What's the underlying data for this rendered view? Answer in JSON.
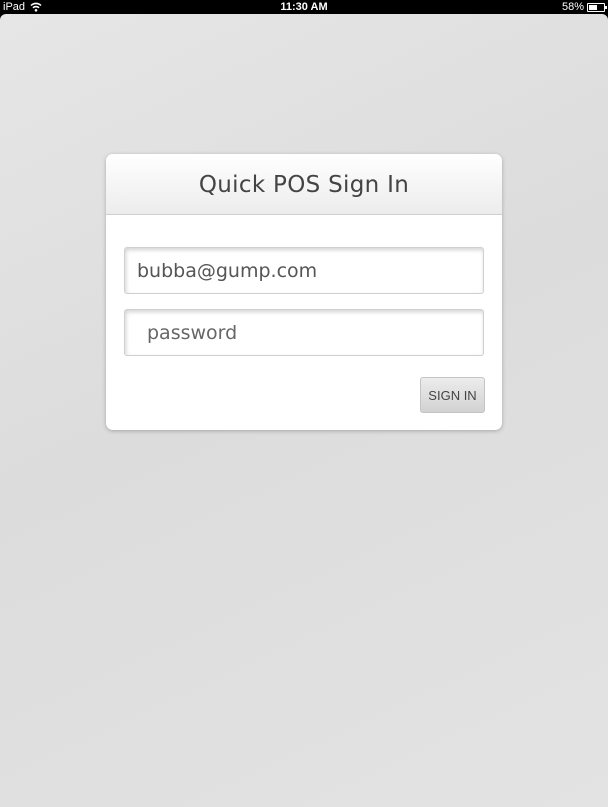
{
  "status_bar": {
    "device": "iPad",
    "time": "11:30 AM",
    "battery": "58%",
    "battery_level": 0.58
  },
  "login": {
    "title": "Quick POS Sign In",
    "email_value": "bubba@gump.com",
    "password_placeholder": "password",
    "signin_label": "SIGN IN"
  },
  "icons": [
    "wifi-icon",
    "battery-icon"
  ]
}
